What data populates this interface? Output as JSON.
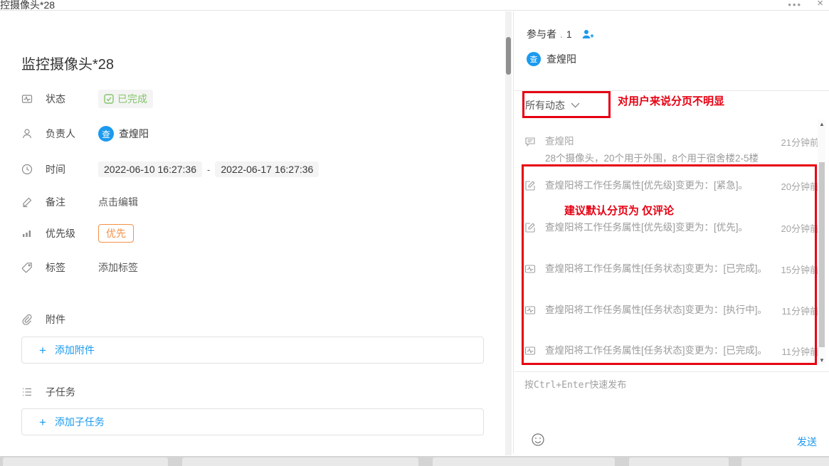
{
  "header": {
    "window_title": "控摄像头*28",
    "more_glyph": "•••",
    "close_glyph": "×"
  },
  "detail": {
    "title": "监控摄像头*28",
    "status": {
      "label": "状态",
      "value": "已完成"
    },
    "assignee": {
      "label": "负责人",
      "name": "查煌阳",
      "avatar_initial": "查"
    },
    "time": {
      "label": "时间",
      "start": "2022-06-10 16:27:36",
      "separator": "-",
      "end": "2022-06-17 16:27:36"
    },
    "note": {
      "label": "备注",
      "placeholder": "点击编辑"
    },
    "priority": {
      "label": "优先级",
      "value": "优先"
    },
    "tags": {
      "label": "标签",
      "placeholder": "添加标签"
    },
    "attachments": {
      "label": "附件",
      "plus": "+",
      "add_label": "添加附件"
    },
    "subtasks": {
      "label": "子任务",
      "plus": "+",
      "add_label": "添加子任务"
    }
  },
  "participants": {
    "label": "参与者",
    "separator": ".",
    "count": "1",
    "member": {
      "name": "查煌阳",
      "avatar_initial": "查"
    }
  },
  "activity": {
    "filter_value": "所有动态",
    "items": [
      {
        "icon": "comment",
        "author": "查煌阳",
        "content": "28个摄像头，20个用于外围，8个用于宿舍楼2-5楼",
        "time": "21分钟前"
      },
      {
        "icon": "edit",
        "text": "查煌阳将工作任务属性[优先级]变更为：[紧急]。",
        "time": "20分钟前"
      },
      {
        "icon": "edit",
        "text": "查煌阳将工作任务属性[优先级]变更为：[优先]。",
        "time": "20分钟前"
      },
      {
        "icon": "status",
        "text": "查煌阳将工作任务属性[任务状态]变更为：[已完成]。",
        "time": "15分钟前"
      },
      {
        "icon": "status",
        "text": "查煌阳将工作任务属性[任务状态]变更为：[执行中]。",
        "time": "11分钟前"
      },
      {
        "icon": "status",
        "text": "查煌阳将工作任务属性[任务状态]变更为：[已完成]。",
        "time": "11分钟前"
      }
    ],
    "scroll_up_glyph": "▲",
    "scroll_down_glyph": "▼"
  },
  "comment_box": {
    "placeholder": "按Ctrl+Enter快速发布",
    "send_label": "发送"
  },
  "annotations": {
    "note1": "对用户来说分页不明显",
    "note2": "建议默认分页为 仅评论"
  },
  "colors": {
    "accent_blue": "#1b9aee",
    "done_green": "#84c56a",
    "priority_orange": "#f39149",
    "annotation_red": "#e60012"
  }
}
